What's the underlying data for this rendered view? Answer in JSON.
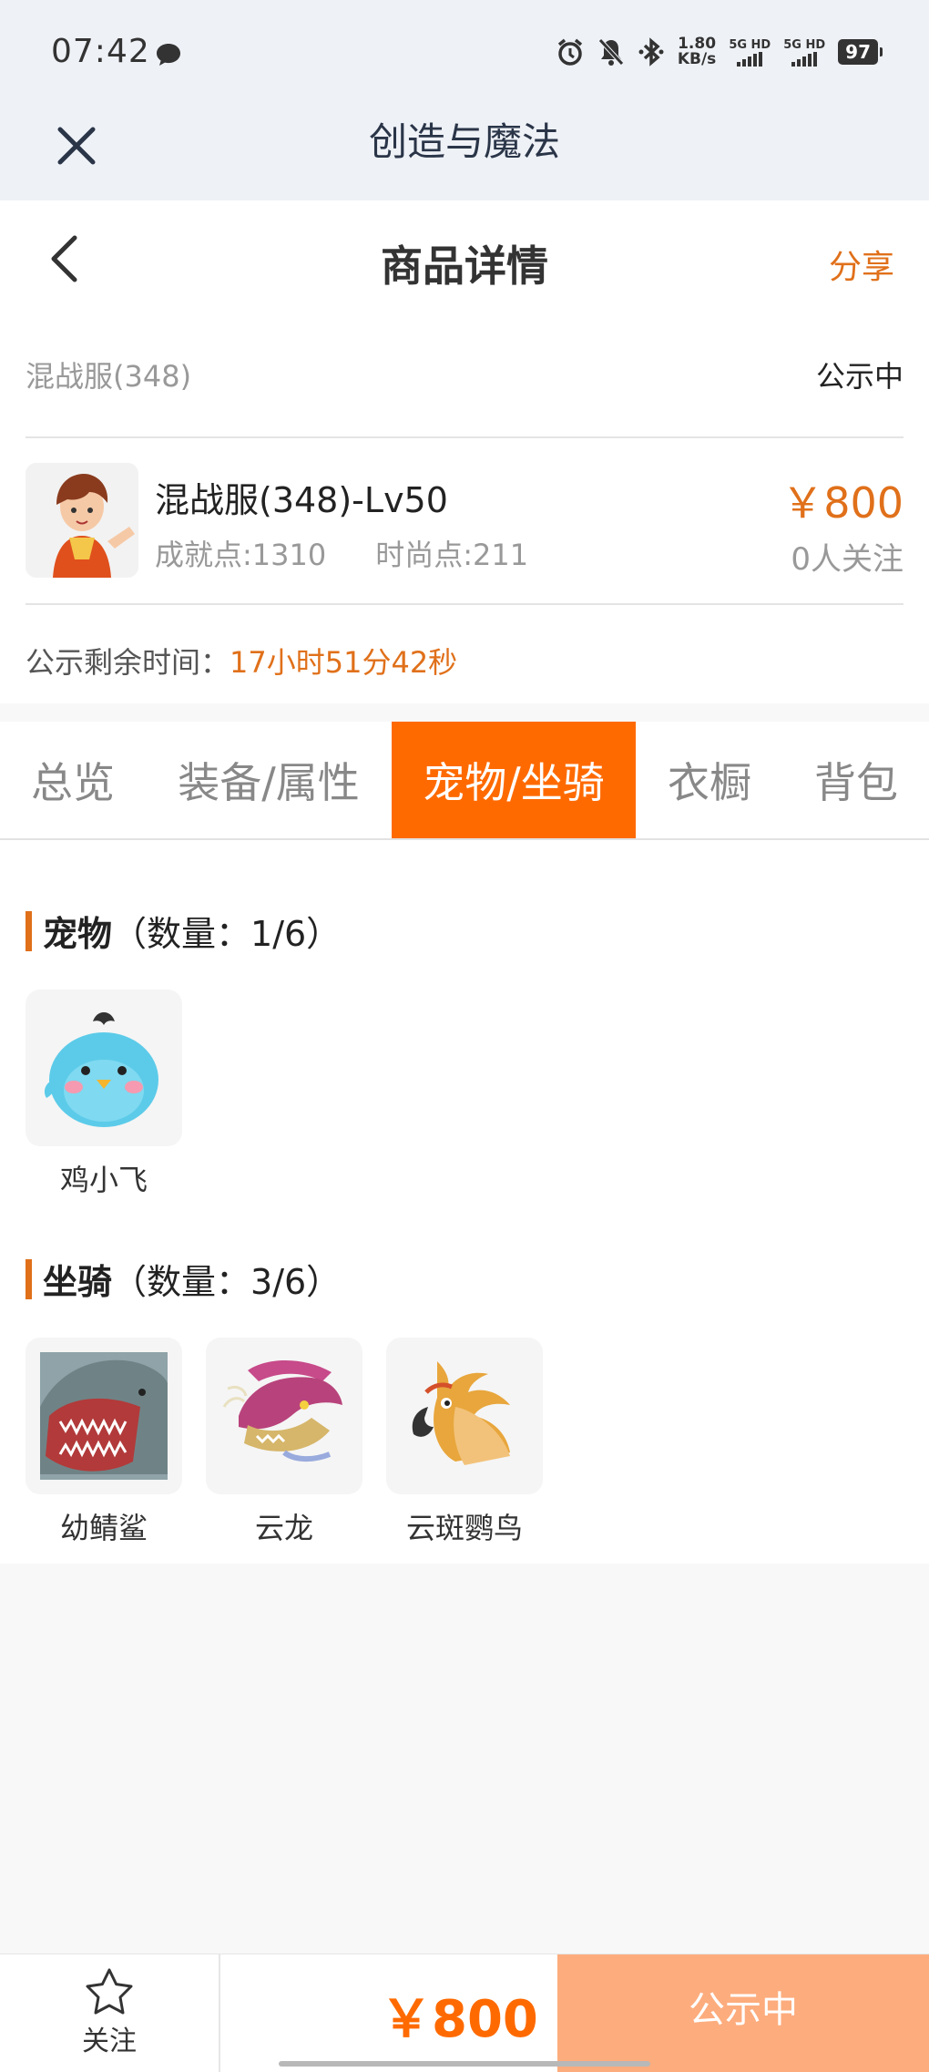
{
  "status_bar": {
    "time": "07:42",
    "net_speed_value": "1.80",
    "net_speed_unit": "KB/s",
    "sim1": "5G HD",
    "sim2": "5G HD",
    "battery": "97"
  },
  "app": {
    "title": "创造与魔法"
  },
  "header": {
    "title": "商品详情",
    "share_label": "分享"
  },
  "listing": {
    "server": "混战服(348)",
    "status": "公示中",
    "character_name": "混战服(348)-Lv50",
    "achievement": "成就点:1310",
    "fashion": "时尚点:211",
    "price": "￥800",
    "followers": "0人关注",
    "remaining_label": "公示剩余时间：",
    "remaining_value": "17小时51分42秒"
  },
  "tabs": [
    {
      "label": "总览",
      "active": false
    },
    {
      "label": "装备/属性",
      "active": false
    },
    {
      "label": "宠物/坐骑",
      "active": true
    },
    {
      "label": "衣橱",
      "active": false
    },
    {
      "label": "背包",
      "active": false
    }
  ],
  "pets": {
    "title": "宠物",
    "count": "（数量：1/6）",
    "items": [
      {
        "name": "鸡小飞",
        "icon": "blue-chick-icon"
      }
    ]
  },
  "mounts": {
    "title": "坐骑",
    "count": "（数量：3/6）",
    "items": [
      {
        "name": "幼鲭鲨",
        "icon": "shark-icon"
      },
      {
        "name": "云龙",
        "icon": "dragon-icon"
      },
      {
        "name": "云斑鹦鸟",
        "icon": "parrot-icon"
      }
    ]
  },
  "bottom_bar": {
    "follow_label": "关注",
    "price": "￥800",
    "action_label": "公示中"
  },
  "colors": {
    "accent": "#ff6a00",
    "price_orange": "#e0701a",
    "action_button": "#fdac7d",
    "status_bar_bg": "#eef1f6"
  }
}
